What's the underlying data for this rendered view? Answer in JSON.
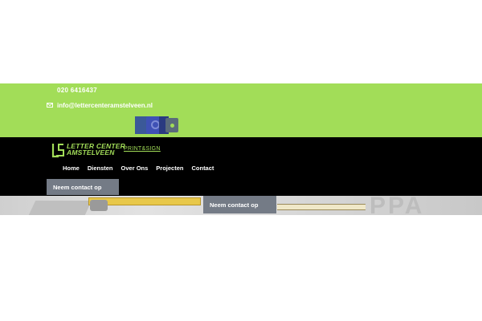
{
  "topbar": {
    "phone": "020 6416437",
    "email": "info@lettercenteramstelveen.nl",
    "bg_color": "#a2dd58",
    "social": [
      "facebook-icon",
      "instagram-icon",
      "linkedin-icon",
      "whatsapp-icon"
    ]
  },
  "header": {
    "logo_line1": "LETTER CENTER",
    "logo_line2": "AMSTELVEEN",
    "tagline": "PRINT&SIGN",
    "nav": [
      {
        "label": "Home"
      },
      {
        "label": "Diensten"
      },
      {
        "label": "Over Ons"
      },
      {
        "label": "Projecten"
      },
      {
        "label": "Contact"
      }
    ],
    "cta_label": "Neem contact op",
    "bg_color": "#000000"
  },
  "hero": {
    "cta_label": "Neem contact op",
    "background_text": "PPA"
  }
}
